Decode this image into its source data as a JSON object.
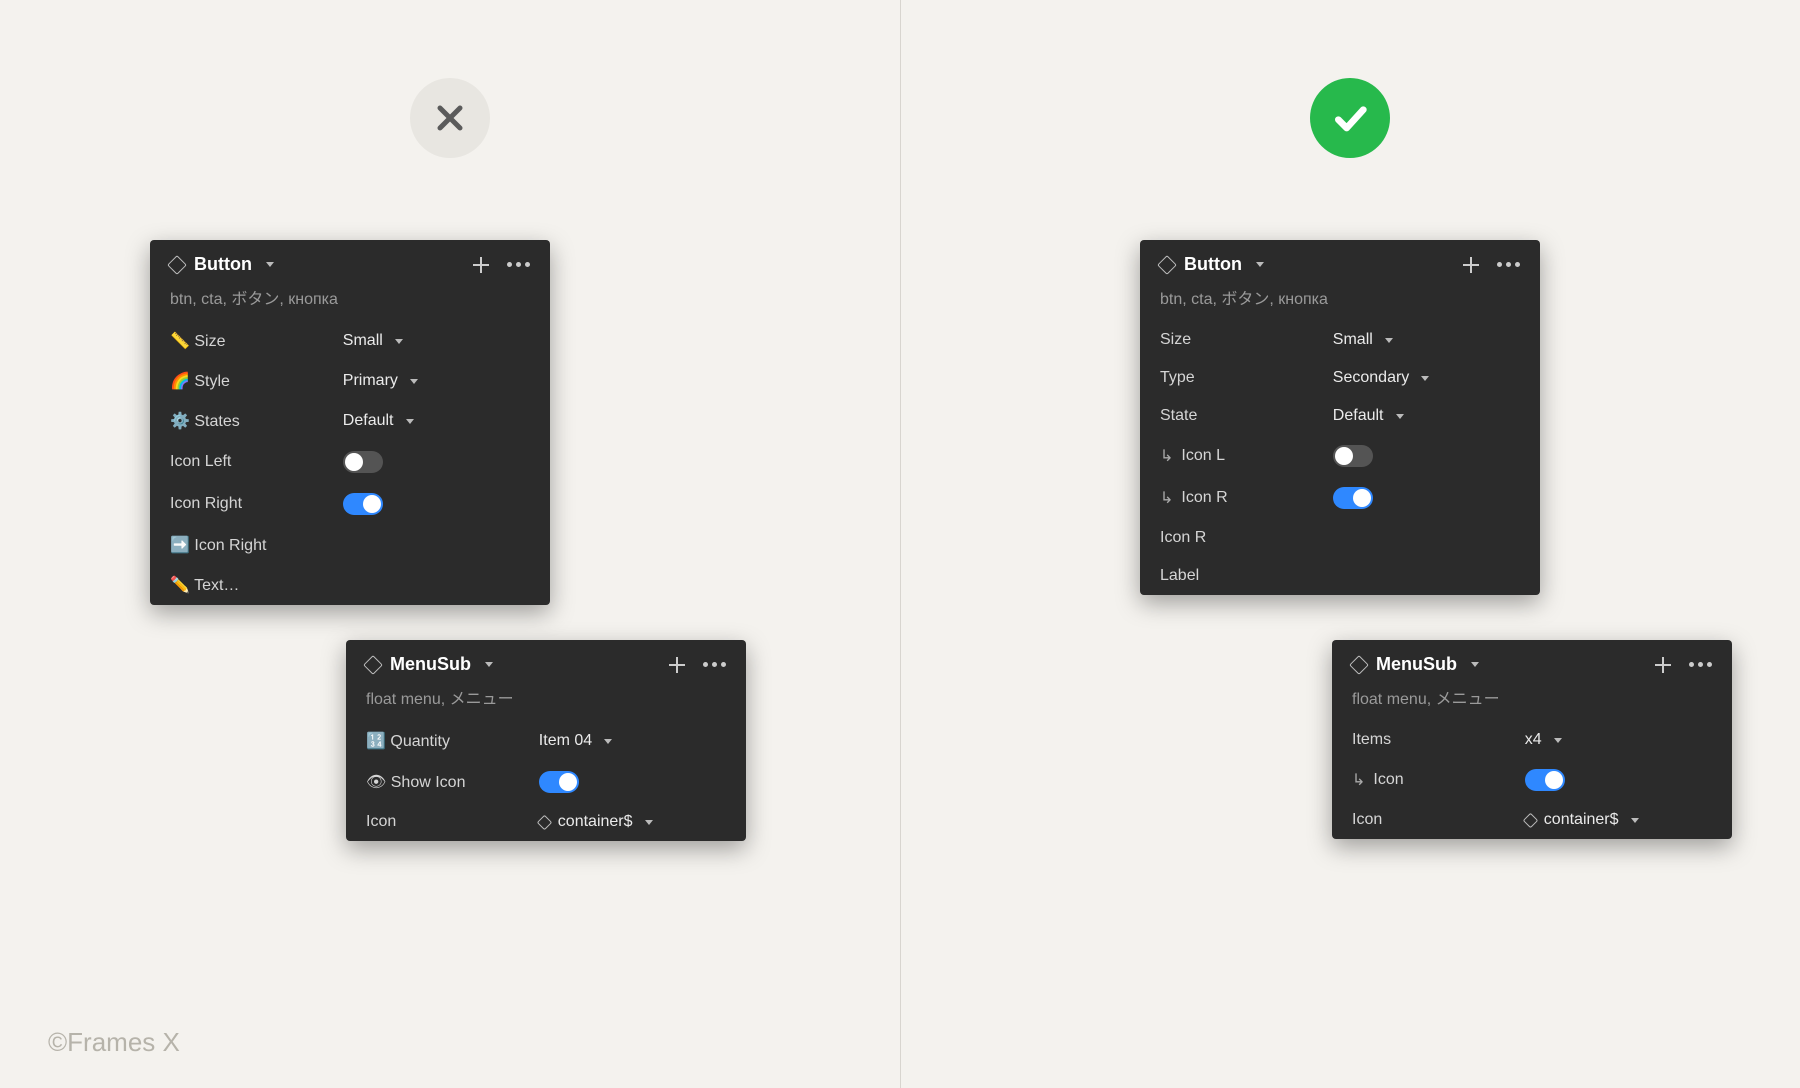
{
  "branding": "©Frames X",
  "left": {
    "button_panel": {
      "title": "Button",
      "tags": "btn, cta, ボタン, кнопка",
      "rows": {
        "size": {
          "label": "📏 Size",
          "value": "Small"
        },
        "style": {
          "label": "🌈 Style",
          "value": "Primary"
        },
        "states": {
          "label": "⚙️ States",
          "value": "Default"
        },
        "icon_left": {
          "label": "Icon Left"
        },
        "icon_right": {
          "label": "Icon Right"
        },
        "icon_r2": {
          "label": "➡️ Icon Right"
        },
        "text": {
          "label": "✏️ Text…"
        }
      }
    },
    "menu_panel": {
      "title": "MenuSub",
      "tags": "float menu, メニュー",
      "rows": {
        "quantity": {
          "label": "🔢 Quantity",
          "value": "Item 04"
        },
        "show": {
          "label": "👁 Show Icon"
        },
        "icon": {
          "label": "Icon",
          "value": "container$"
        }
      }
    }
  },
  "right": {
    "button_panel": {
      "title": "Button",
      "tags": "btn, cta, ボタン, кнопка",
      "rows": {
        "size": {
          "label": "Size",
          "value": "Small"
        },
        "type": {
          "label": "Type",
          "value": "Secondary"
        },
        "state": {
          "label": "State",
          "value": "Default"
        },
        "icon_l": {
          "label": "Icon L"
        },
        "icon_r": {
          "label": "Icon R"
        },
        "icon_r2": {
          "label": "Icon R"
        },
        "label_row": {
          "label": "Label"
        }
      }
    },
    "menu_panel": {
      "title": "MenuSub",
      "tags": "float menu, メニュー",
      "rows": {
        "items": {
          "label": "Items",
          "value": "x4"
        },
        "icon_t": {
          "label": "Icon"
        },
        "icon": {
          "label": "Icon",
          "value": "container$"
        }
      }
    }
  }
}
